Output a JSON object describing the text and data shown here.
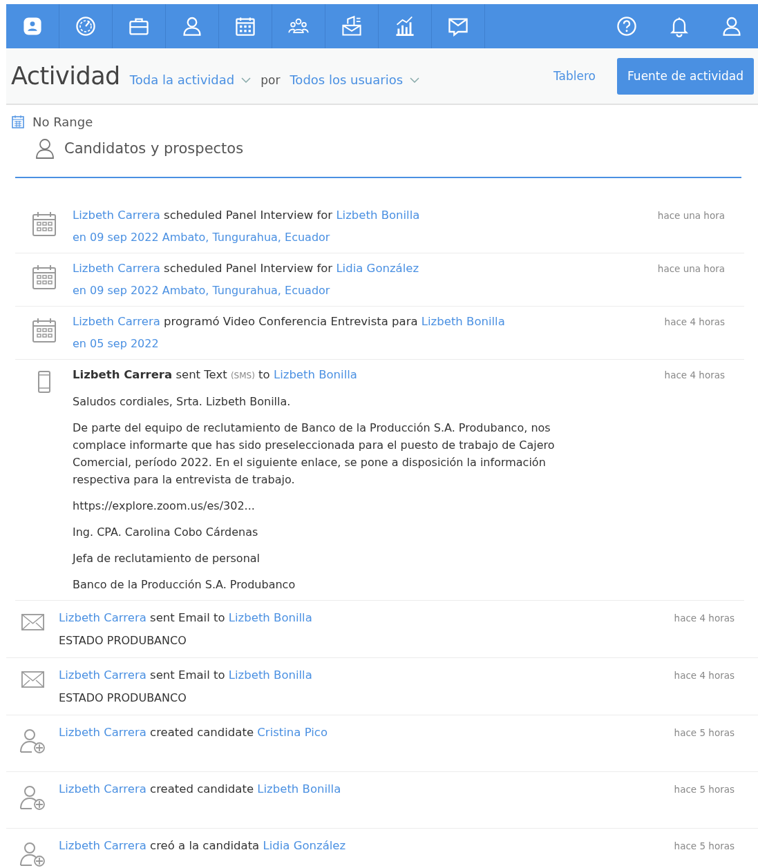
{
  "header": {
    "title": "Actividad",
    "filter": "Toda la actividad",
    "joiner": "por",
    "users": "Todos los usuarios",
    "tabs": [
      {
        "label": "Tablero",
        "selected": false
      },
      {
        "label": "Fuente de actividad",
        "selected": true
      }
    ]
  },
  "range": "No Range",
  "section": "Candidatos y prospectos",
  "feed": [
    {
      "kind": "event",
      "title": [
        {
          "kind": "link",
          "text": "Lizbeth Carrera"
        },
        {
          "kind": "plain",
          "text": " scheduled Panel Interview for "
        },
        {
          "kind": "link",
          "text": "Lizbeth Bonilla"
        }
      ],
      "lines": [
        {
          "kind": "link",
          "text": "en 09 sep 2022  Ambato, Tungurahua, Ecuador"
        }
      ],
      "time": "hace una hora"
    },
    {
      "kind": "event",
      "title": [
        {
          "kind": "link",
          "text": "Lizbeth Carrera"
        },
        {
          "kind": "plain",
          "text": " scheduled Panel Interview for "
        },
        {
          "kind": "link",
          "text": "Lidia González"
        }
      ],
      "lines": [
        {
          "kind": "link",
          "text": "en 09 sep 2022  Ambato, Tungurahua, Ecuador"
        }
      ],
      "time": "hace una hora"
    },
    {
      "kind": "event",
      "title": [
        {
          "kind": "link",
          "text": "Lizbeth Carrera"
        },
        {
          "kind": "plain",
          "text": " programó Video Conferencia Entrevista para "
        },
        {
          "kind": "link",
          "text": "Lizbeth Bonilla"
        }
      ],
      "lines": [
        {
          "kind": "link",
          "text": "en 05 sep 2022"
        }
      ],
      "time": "hace 4 horas"
    },
    {
      "kind": "sms",
      "title": [
        {
          "kind": "strong",
          "text": "Lizbeth Carrera"
        },
        {
          "kind": "plain",
          "text": " sent Text "
        },
        {
          "kind": "small",
          "text": "(SMS)"
        },
        {
          "kind": "plain",
          "text": " to "
        },
        {
          "kind": "link",
          "text": "Lizbeth Bonilla"
        }
      ],
      "lines": [
        {
          "kind": "plain",
          "text": "Saludos cordiales, Srta. Lizbeth Bonilla."
        },
        {
          "kind": "plain",
          "text": "De parte del equipo de reclutamiento de Banco de la Producción S.A. Produbanco, nos complace informarte que has sido preseleccionada para el puesto de trabajo de Cajero Comercial, período 2022. En el siguiente enlace, se pone a disposición la información respectiva para la entrevista de trabajo."
        },
        {
          "kind": "plain",
          "text": "https://explore.zoom.us/es/302..."
        },
        {
          "kind": "plain",
          "text": "Ing. CPA. Carolina Cobo Cárdenas"
        },
        {
          "kind": "plain",
          "text": "Jefa de reclutamiento de personal"
        },
        {
          "kind": "plain",
          "text": "Banco de la Producción S.A. Produbanco"
        }
      ],
      "time": "hace 4 horas"
    }
  ],
  "feed_continued": [
    {
      "kind": "email",
      "title": [
        {
          "kind": "link",
          "text": "Lizbeth Carrera"
        },
        {
          "kind": "plain",
          "text": " sent Email to "
        },
        {
          "kind": "link",
          "text": "Lizbeth Bonilla"
        }
      ],
      "lines": [
        {
          "kind": "plain",
          "text": "ESTADO PRODUBANCO"
        }
      ],
      "time": "hace 4 horas"
    },
    {
      "kind": "email",
      "title": [
        {
          "kind": "link",
          "text": "Lizbeth Carrera"
        },
        {
          "kind": "plain",
          "text": " sent Email to "
        },
        {
          "kind": "link",
          "text": "Lizbeth Bonilla"
        }
      ],
      "lines": [
        {
          "kind": "plain",
          "text": "ESTADO PRODUBANCO"
        }
      ],
      "time": "hace 4 horas"
    },
    {
      "kind": "candidate",
      "title": [
        {
          "kind": "link",
          "text": "Lizbeth Carrera"
        },
        {
          "kind": "plain",
          "text": " created candidate "
        },
        {
          "kind": "link",
          "text": "Cristina Pico"
        }
      ],
      "time": "hace 5 horas"
    },
    {
      "kind": "candidate",
      "title": [
        {
          "kind": "link",
          "text": "Lizbeth Carrera"
        },
        {
          "kind": "plain",
          "text": " created candidate "
        },
        {
          "kind": "link",
          "text": "Lizbeth Bonilla"
        }
      ],
      "time": "hace 5 horas"
    },
    {
      "kind": "candidate",
      "title": [
        {
          "kind": "link",
          "text": "Lizbeth Carrera"
        },
        {
          "kind": "plain",
          "text": " creó a la candidata "
        },
        {
          "kind": "link",
          "text": "Lidia González"
        }
      ],
      "time": "hace 5 horas"
    }
  ]
}
